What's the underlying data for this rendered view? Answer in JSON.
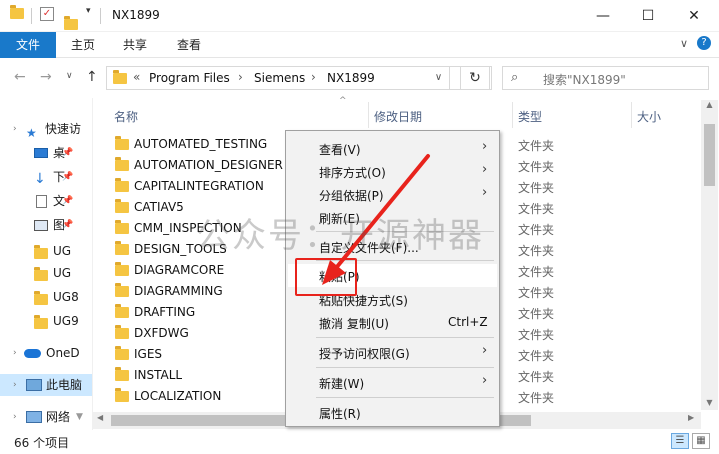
{
  "window": {
    "title": "NX1899",
    "minimize": "—",
    "maximize": "☐",
    "close": "✕"
  },
  "ribbon": {
    "tabs": [
      "文件",
      "主页",
      "共享",
      "查看"
    ],
    "chevron": "∨",
    "help": "?"
  },
  "address": {
    "back": "←",
    "forward": "→",
    "recent": "∨",
    "up": "↑",
    "prefix": "«",
    "crumbs": [
      "Program Files",
      "Siemens",
      "NX1899"
    ],
    "separator": "›",
    "dropdown": "∨",
    "refresh": "↻"
  },
  "search": {
    "icon": "search-icon",
    "placeholder": "搜索\"NX1899\""
  },
  "sidebar": {
    "items": [
      {
        "label": "快速访",
        "icon": "star-icon"
      },
      {
        "label": "桌",
        "icon": "desktop-icon"
      },
      {
        "label": "下",
        "icon": "download-icon"
      },
      {
        "label": "文",
        "icon": "document-icon"
      },
      {
        "label": "图",
        "icon": "picture-icon"
      },
      {
        "label": "UG",
        "icon": "folder-icon"
      },
      {
        "label": "UG",
        "icon": "folder-icon"
      },
      {
        "label": "UG8",
        "icon": "folder-icon"
      },
      {
        "label": "UG9",
        "icon": "folder-icon"
      },
      {
        "label": "OneD",
        "icon": "cloud-icon"
      },
      {
        "label": "此电脑",
        "icon": "computer-icon"
      },
      {
        "label": "网络",
        "icon": "network-icon"
      }
    ]
  },
  "columns": {
    "name": "名称",
    "date": "修改日期",
    "type": "类型",
    "size": "大小"
  },
  "files": [
    {
      "name": "AUTOMATED_TESTING",
      "type": "文件夹"
    },
    {
      "name": "AUTOMATION_DESIGNER",
      "type": "文件夹"
    },
    {
      "name": "CAPITALINTEGRATION",
      "type": "文件夹"
    },
    {
      "name": "CATIAV5",
      "type": "文件夹"
    },
    {
      "name": "CMM_INSPECTION",
      "type": "文件夹"
    },
    {
      "name": "DESIGN_TOOLS",
      "type": "文件夹"
    },
    {
      "name": "DIAGRAMCORE",
      "type": "文件夹"
    },
    {
      "name": "DIAGRAMMING",
      "type": "文件夹"
    },
    {
      "name": "DRAFTING",
      "type": "文件夹"
    },
    {
      "name": "DXFDWG",
      "type": "文件夹"
    },
    {
      "name": "IGES",
      "type": "文件夹"
    },
    {
      "name": "INSTALL",
      "type": "文件夹"
    },
    {
      "name": "LOCALIZATION",
      "type": "文件夹"
    }
  ],
  "context_menu": {
    "view": "查看(V)",
    "sort": "排序方式(O)",
    "group": "分组依据(P)",
    "refresh": "刷新(E)",
    "customize": "自定义文件夹(F)...",
    "paste": "粘贴(P)",
    "paste_shortcut": "粘贴快捷方式(S)",
    "undo": "撤消 复制(U)",
    "undo_shortcut": "Ctrl+Z",
    "access": "授予访问权限(G)",
    "new": "新建(W)",
    "properties": "属性(R)",
    "submenu_arrow": "›"
  },
  "status": {
    "count": "66 个项目"
  },
  "watermark": "公众号：开源神器",
  "colors": {
    "file_tab": "#1979ca",
    "selection": "#cce8ff",
    "highlight_red": "#e8231c",
    "folder": "#f5c542"
  }
}
